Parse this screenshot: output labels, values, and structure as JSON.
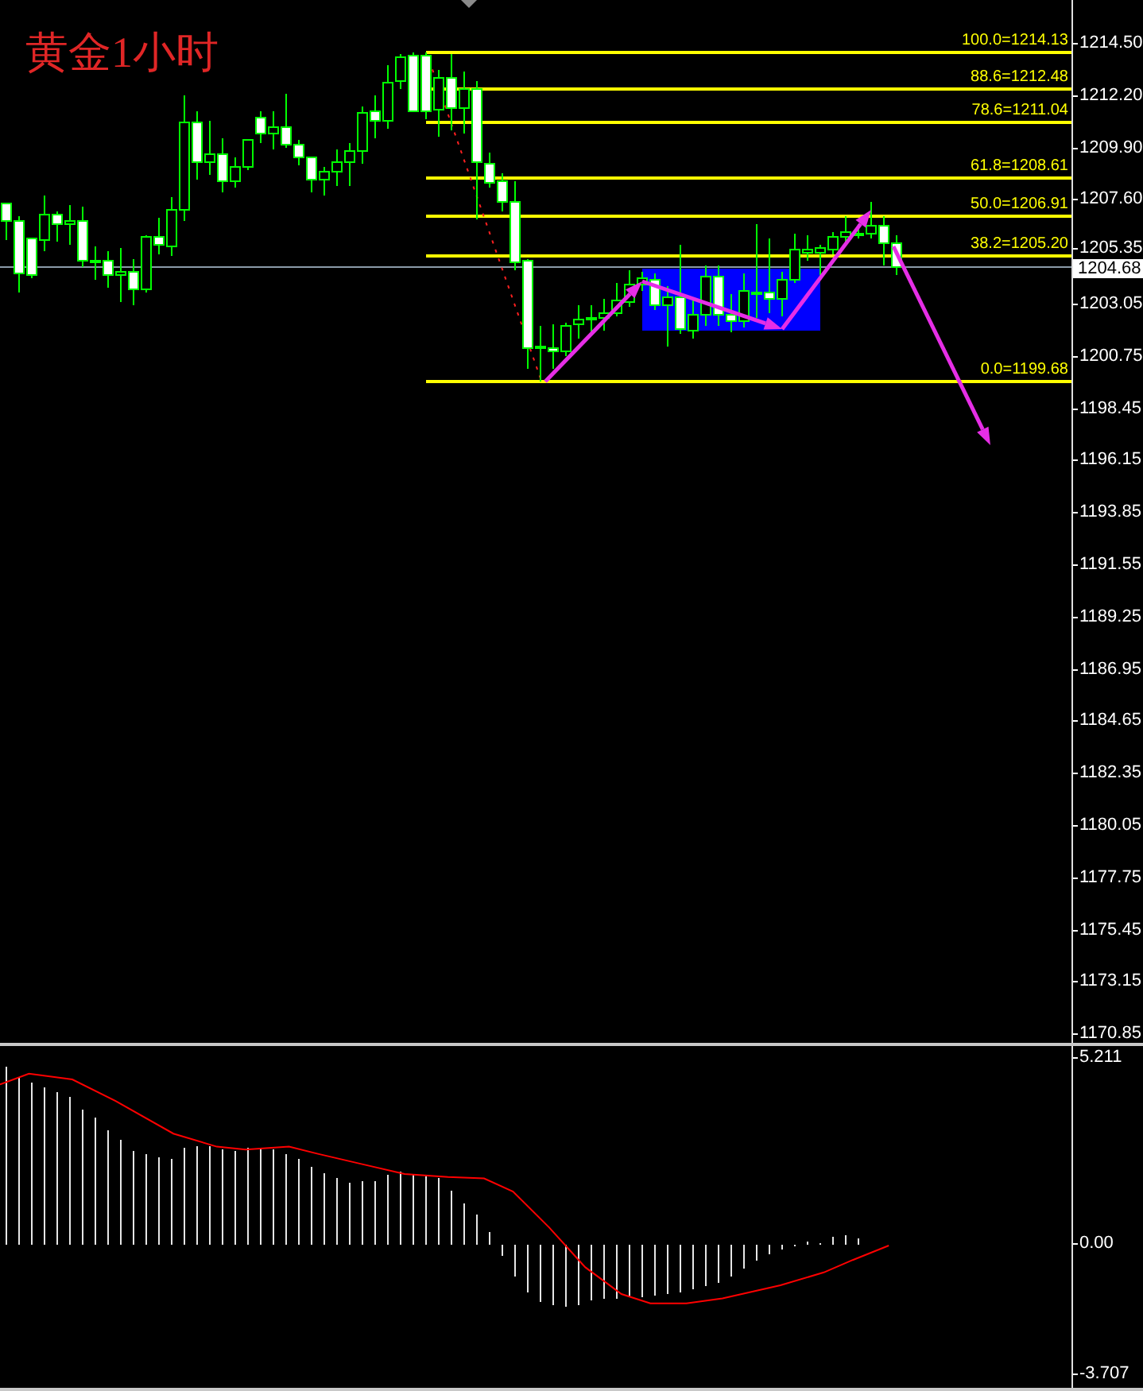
{
  "title": "黄金1小时",
  "fibonacci_levels": [
    {
      "label": "100.0=1214.13"
    },
    {
      "label": "88.6=1212.48"
    },
    {
      "label": "78.6=1211.04"
    },
    {
      "label": "61.8=1208.61"
    },
    {
      "label": "50.0=1206.91"
    },
    {
      "label": "38.2=1205.20"
    },
    {
      "label": "0.0=1199.68"
    }
  ],
  "price_axis": {
    "ticks": [
      "1214.50",
      "1212.20",
      "1209.90",
      "1207.60",
      "1205.35",
      "1203.05",
      "1200.75",
      "1198.45",
      "1196.15",
      "1193.85",
      "1191.55",
      "1189.25",
      "1186.95",
      "1184.65",
      "1182.35",
      "1180.05",
      "1177.75",
      "1175.45",
      "1173.15",
      "1170.85"
    ],
    "current_price": "1204.68"
  },
  "macd_axis": {
    "ticks": [
      "5.211",
      "0.00",
      "-3.707"
    ]
  }
}
